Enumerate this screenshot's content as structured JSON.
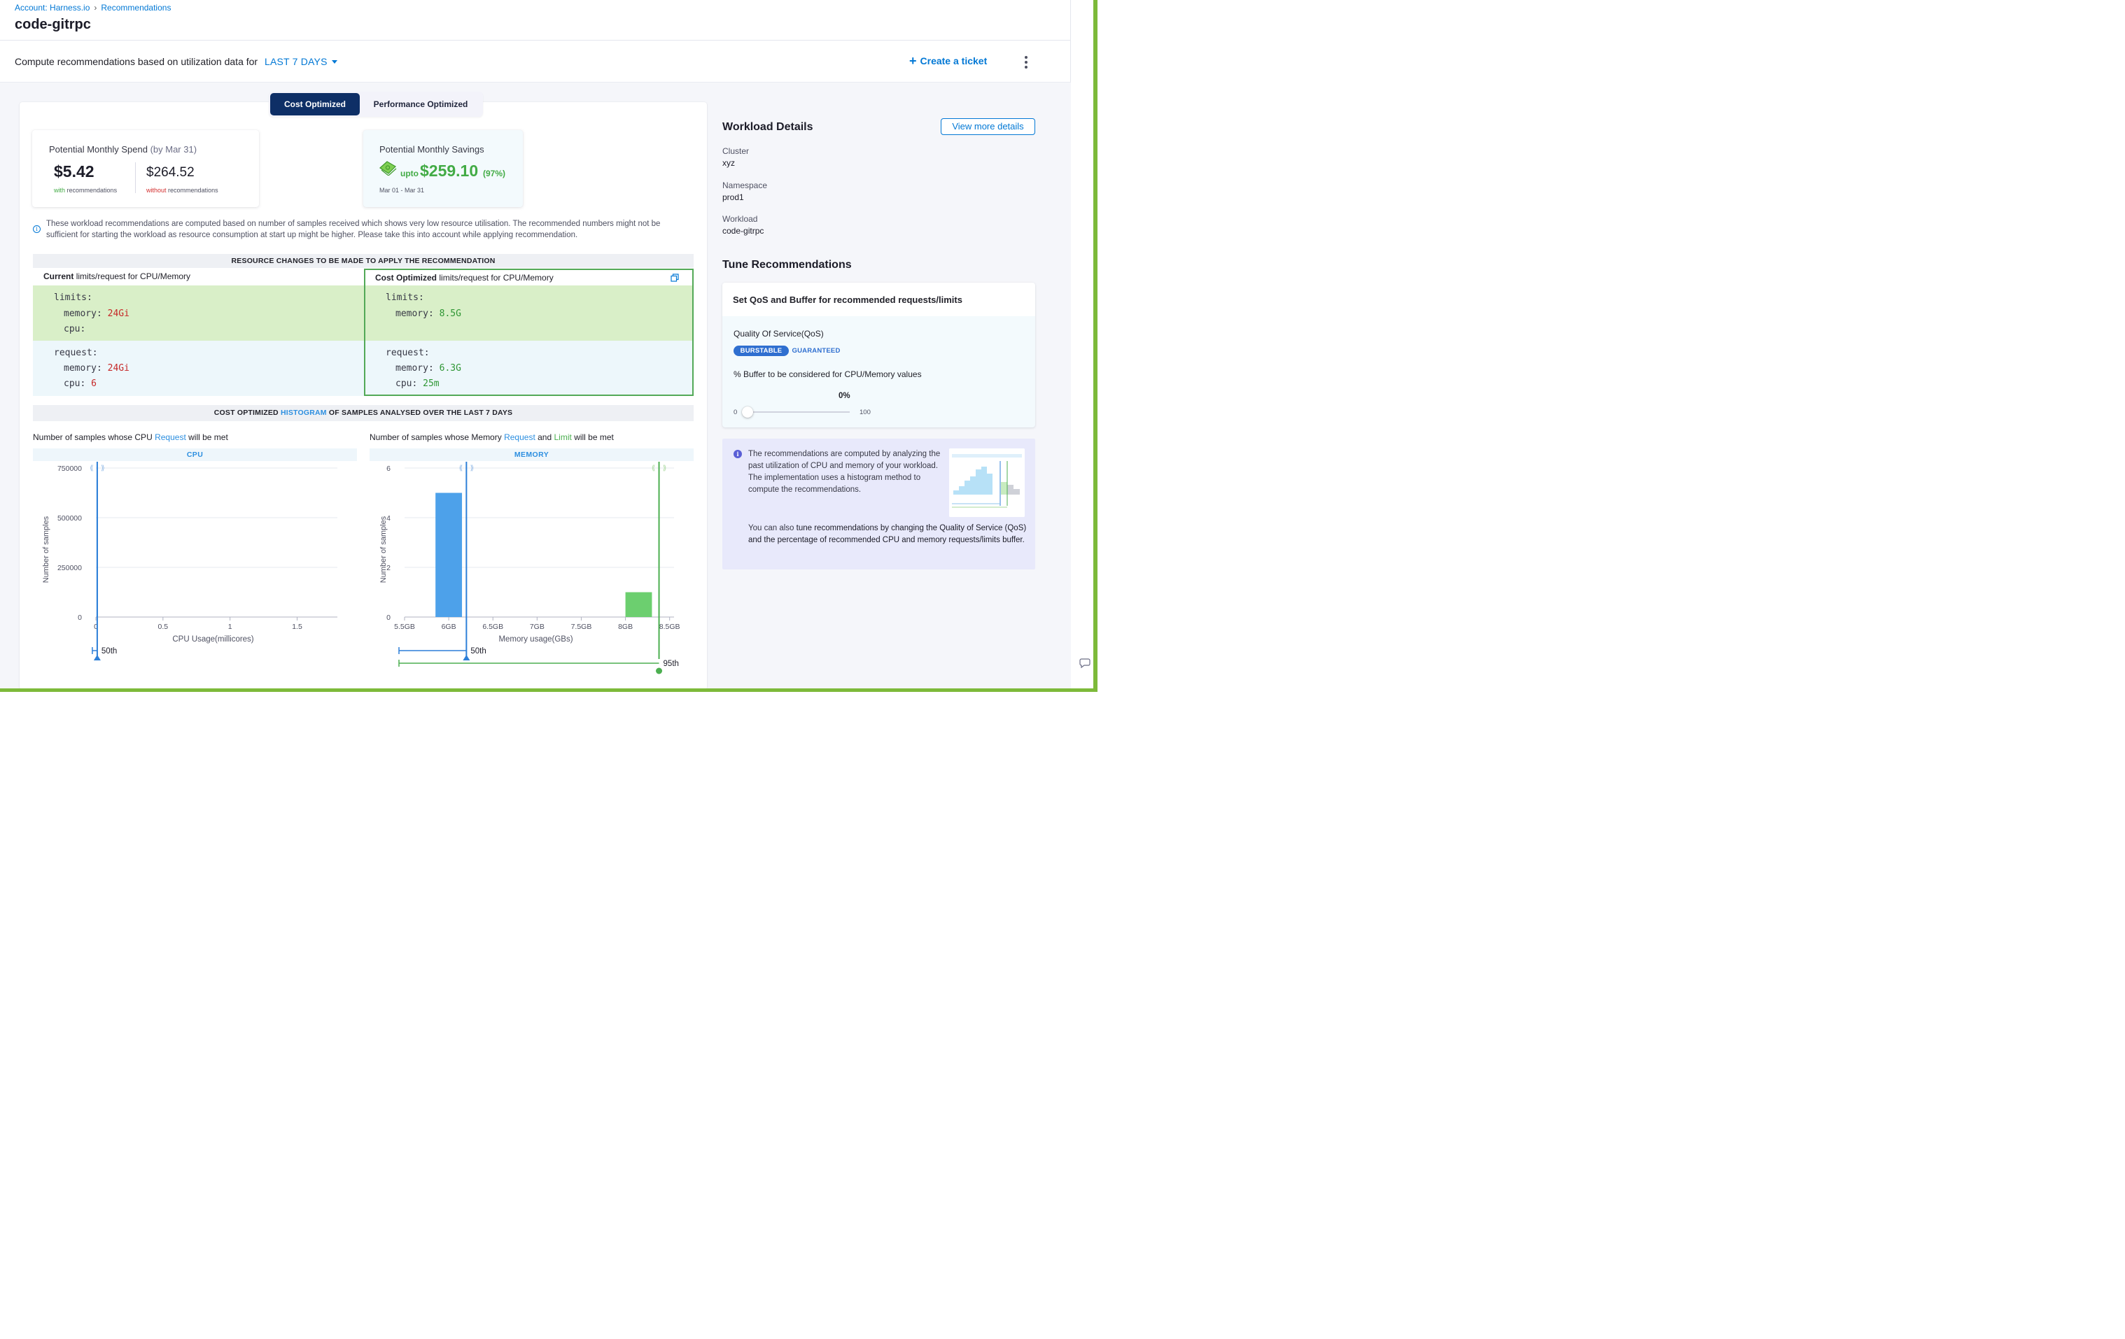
{
  "breadcrumb": {
    "account": "Account: Harness.io",
    "separator": "›",
    "page": "Recommendations"
  },
  "page_title": "code-gitrpc",
  "toolbar": {
    "label": "Compute recommendations based on utilization data for",
    "period": "LAST 7 DAYS",
    "create_ticket": "Create a ticket",
    "create_ticket_icon": "plus-icon",
    "more_icon": "kebab-menu-icon"
  },
  "mode_toggle": {
    "options": [
      "Cost Optimized",
      "Performance Optimized"
    ],
    "selected": "Cost Optimized"
  },
  "spend": {
    "title": "Potential Monthly Spend",
    "by": "(by Mar 31)",
    "with_value": "$5.42",
    "with_label_accent": "with",
    "with_label_rest": "recommendations",
    "without_value": "$264.52",
    "without_label_accent": "without",
    "without_label_rest": "recommendations"
  },
  "savings": {
    "title": "Potential Monthly Savings",
    "icon": "money-icon",
    "upto": "upto",
    "amount": "$259.10",
    "percent": "(97%)",
    "range": "Mar 01 - Mar 31"
  },
  "info_note": "These workload recommendations are computed based on number of samples received which shows very low resource utilisation. The recommended numbers might not be sufficient for starting the workload as resource consumption at start up might be higher. Please take this into account while applying recommendation.",
  "resource_changes": {
    "heading": "RESOURCE CHANGES TO BE MADE TO APPLY THE RECOMMENDATION",
    "current_head_bold": "Current",
    "current_head_rest": "limits/request for CPU/Memory",
    "optimized_head_bold": "Cost Optimized",
    "optimized_head_rest": "limits/request for CPU/Memory",
    "current": {
      "limits_key": "limits:",
      "limits_memory_key": "memory:",
      "limits_memory": "24Gi",
      "limits_cpu_key": "cpu:",
      "limits_cpu": "",
      "request_key": "request:",
      "request_memory_key": "memory:",
      "request_memory": "24Gi",
      "request_cpu_key": "cpu:",
      "request_cpu": "6"
    },
    "optimized": {
      "limits_key": "limits:",
      "limits_memory_key": "memory:",
      "limits_memory": "8.5G",
      "request_key": "request:",
      "request_memory_key": "memory:",
      "request_memory": "6.3G",
      "request_cpu_key": "cpu:",
      "request_cpu": "25m"
    }
  },
  "histogram_section": {
    "heading_pre": "COST OPTIMIZED",
    "heading_link": "HISTOGRAM",
    "heading_post": "OF SAMPLES ANALYSED OVER THE LAST 7 DAYS",
    "cpu_title_pre": "Number of samples whose CPU",
    "cpu_title_link": "Request",
    "cpu_title_post": "will be met",
    "mem_title_pre": "Number of samples whose Memory",
    "mem_title_link1": "Request",
    "mem_title_mid": "and",
    "mem_title_link2": "Limit",
    "mem_title_post": "will be met",
    "cpu_band": "CPU",
    "mem_band": "MEMORY"
  },
  "chart_data": [
    {
      "type": "bar",
      "title": "CPU",
      "xlabel": "CPU Usage(millicores)",
      "ylabel": "Number of samples",
      "x_ticks": [
        "0",
        "0.5",
        "1",
        "1.5"
      ],
      "y_ticks": [
        "0",
        "250000",
        "500000",
        "750000"
      ],
      "ylim": [
        0,
        750000
      ],
      "xlim": [
        0,
        1.8
      ],
      "series": [
        {
          "values": [
            {
              "x": 0.01,
              "y": 690000
            }
          ]
        }
      ],
      "markers": [
        {
          "label": "50th",
          "x": 0.01,
          "color": "#2d7fd8"
        }
      ],
      "grid": true
    },
    {
      "type": "bar",
      "title": "MEMORY",
      "xlabel": "Memory usage(GBs)",
      "ylabel": "Number of samples",
      "x_ticks": [
        "5.5GB",
        "6GB",
        "6.5GB",
        "7GB",
        "7.5GB",
        "8GB",
        "8.5GB"
      ],
      "y_ticks": [
        "0",
        "2",
        "4",
        "6"
      ],
      "ylim": [
        0,
        6
      ],
      "xlim": [
        5.5,
        8.55
      ],
      "series": [
        {
          "values": [
            {
              "x0": 5.85,
              "x1": 6.15,
              "y": 5
            }
          ],
          "color": "#4da1ea"
        },
        {
          "values": [
            {
              "x0": 8.0,
              "x1": 8.3,
              "y": 1
            }
          ],
          "color": "#6ccf6f"
        }
      ],
      "markers": [
        {
          "label": "50th",
          "x": 6.2,
          "color": "#2d7fd8"
        },
        {
          "label": "95th",
          "x": 8.38,
          "color": "#4caf50"
        }
      ],
      "grid": true
    }
  ],
  "workload": {
    "title": "Workload Details",
    "view_more": "View more details",
    "cluster_label": "Cluster",
    "cluster": "xyz",
    "namespace_label": "Namespace",
    "namespace": "prod1",
    "workload_label": "Workload",
    "workload": "code-gitrpc"
  },
  "tune": {
    "title": "Tune Recommendations",
    "card_title": "Set QoS and Buffer for recommended requests/limits",
    "qos_label": "Quality Of Service(QoS)",
    "qos_options": [
      "BURSTABLE",
      "GUARANTEED"
    ],
    "qos_selected": "BURSTABLE",
    "buffer_label": "% Buffer to be considered for CPU/Memory values",
    "buffer_value": "0%",
    "buffer_fraction": 0,
    "slider_min": "0",
    "slider_max": "100"
  },
  "explain": {
    "p1": "The recommendations are computed by analyzing the past utilization of CPU and memory of your workload. The implementation uses a histogram method to compute the recommendations.",
    "p2_pre": "You can also",
    "p2_rest": "tune recommendations by changing the Quality of Service (QoS) and the percentage of recommended CPU and memory requests/limits buffer."
  },
  "colors": {
    "accent": "#0278d5",
    "active_toggle": "#0e2f66",
    "savings_green": "#42ab45",
    "request_blue": "#4da1ea",
    "limit_green": "#6ccf6f",
    "frame_green": "#7dba3a"
  }
}
